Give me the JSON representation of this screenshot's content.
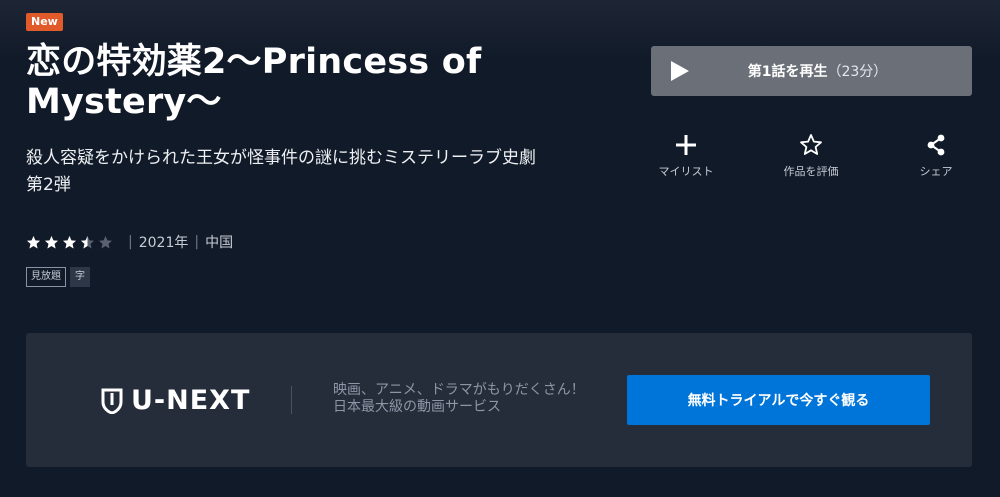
{
  "badge": {
    "label": "New"
  },
  "title": "恋の特効薬2～Princess of Mystery～",
  "synopsis": "殺人容疑をかけられた王女が怪事件の謎に挑むミステリーラブ史劇第2弾",
  "rating": {
    "value": 3.5,
    "max": 5
  },
  "meta": {
    "year": "2021年",
    "country": "中国",
    "separator": "|"
  },
  "tags": [
    "見放題",
    "字"
  ],
  "play": {
    "label": "第1話を再生",
    "duration": "（23分）"
  },
  "actions": [
    {
      "label": "マイリスト",
      "icon": "plus-icon"
    },
    {
      "label": "作品を評価",
      "icon": "star-outline-icon"
    },
    {
      "label": "シェア",
      "icon": "share-icon"
    }
  ],
  "promo": {
    "logo_text": "U-NEXT",
    "line1": "映画、アニメ、ドラマがもりだくさん！",
    "line2": "日本最大級の動画サービス",
    "cta_label": "無料トライアルで今すぐ観る"
  },
  "colors": {
    "background": "#111a28",
    "badge": "#e15a2a",
    "play_button": "#6a6f78",
    "promo_panel": "#252c3a",
    "cta": "#0075d9"
  }
}
